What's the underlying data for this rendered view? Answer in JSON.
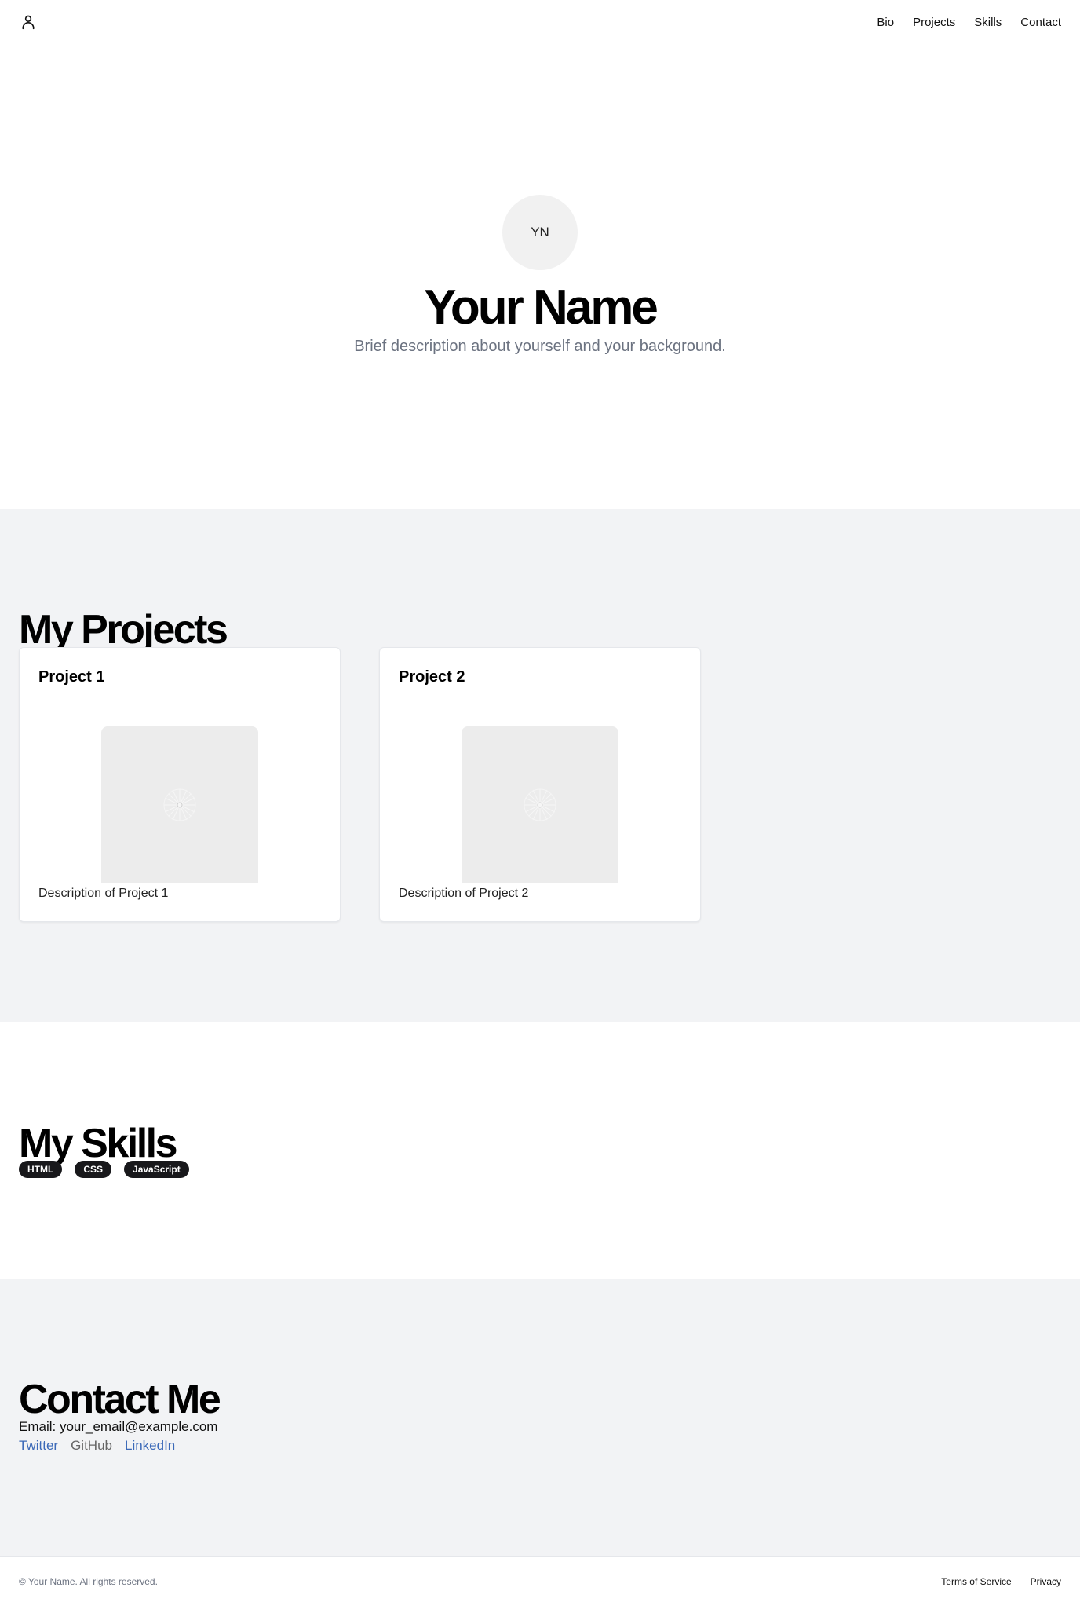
{
  "header": {
    "logo_icon": "user-icon",
    "nav": [
      {
        "label": "Bio"
      },
      {
        "label": "Projects"
      },
      {
        "label": "Skills"
      },
      {
        "label": "Contact"
      }
    ]
  },
  "hero": {
    "avatar_initials": "YN",
    "name": "Your Name",
    "description": "Brief description about yourself and your background."
  },
  "projects": {
    "title": "My Projects",
    "items": [
      {
        "title": "Project 1",
        "image_icon": "image-placeholder-icon",
        "description": "Description of Project 1"
      },
      {
        "title": "Project 2",
        "image_icon": "image-placeholder-icon",
        "description": "Description of Project 2"
      }
    ]
  },
  "skills": {
    "title": "My Skills",
    "items": [
      "HTML",
      "CSS",
      "JavaScript"
    ]
  },
  "contact": {
    "title": "Contact Me",
    "email": "Email: your_email@example.com",
    "links": [
      {
        "label": "Twitter",
        "color": "#3b69b8"
      },
      {
        "label": "GitHub",
        "color": "#666666"
      },
      {
        "label": "LinkedIn",
        "color": "#3b69b8"
      }
    ]
  },
  "footer": {
    "copyright": "© Your Name. All rights reserved.",
    "links": [
      {
        "label": "Terms of Service"
      },
      {
        "label": "Privacy"
      }
    ]
  },
  "colors": {
    "section_alt_background": "#f2f3f5",
    "badge_background": "#18181b",
    "muted_text": "#6b7280"
  }
}
